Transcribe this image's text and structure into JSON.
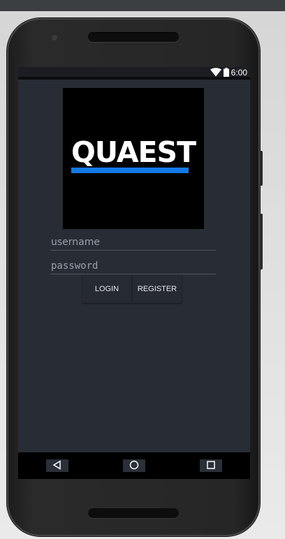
{
  "device": {
    "status_bar": {
      "time": "6:00",
      "icons": [
        "wifi-icon",
        "battery-icon"
      ]
    },
    "navigation": {
      "keys": [
        "back-icon",
        "home-icon",
        "recents-icon"
      ]
    }
  },
  "app": {
    "logo": {
      "text": "QUAEST",
      "accent_color": "#1479e6"
    },
    "form": {
      "username": {
        "value": "",
        "placeholder": "username"
      },
      "password": {
        "value": "",
        "placeholder": "password"
      },
      "login_label": "LOGIN",
      "register_label": "REGISTER"
    }
  },
  "colors": {
    "screen_background": "#282c35",
    "logo_background": "#000000"
  }
}
